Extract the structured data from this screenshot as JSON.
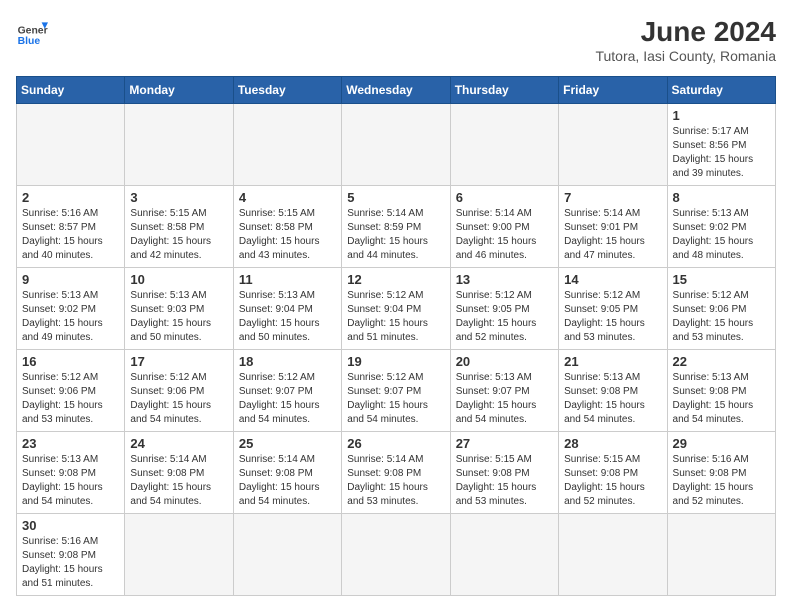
{
  "header": {
    "logo_general": "General",
    "logo_blue": "Blue",
    "title": "June 2024",
    "subtitle": "Tutora, Iasi County, Romania"
  },
  "days_of_week": [
    "Sunday",
    "Monday",
    "Tuesday",
    "Wednesday",
    "Thursday",
    "Friday",
    "Saturday"
  ],
  "weeks": [
    [
      {
        "day": "",
        "info": ""
      },
      {
        "day": "",
        "info": ""
      },
      {
        "day": "",
        "info": ""
      },
      {
        "day": "",
        "info": ""
      },
      {
        "day": "",
        "info": ""
      },
      {
        "day": "",
        "info": ""
      },
      {
        "day": "1",
        "info": "Sunrise: 5:17 AM\nSunset: 8:56 PM\nDaylight: 15 hours and 39 minutes."
      }
    ],
    [
      {
        "day": "2",
        "info": "Sunrise: 5:16 AM\nSunset: 8:57 PM\nDaylight: 15 hours and 40 minutes."
      },
      {
        "day": "3",
        "info": "Sunrise: 5:15 AM\nSunset: 8:58 PM\nDaylight: 15 hours and 42 minutes."
      },
      {
        "day": "4",
        "info": "Sunrise: 5:15 AM\nSunset: 8:58 PM\nDaylight: 15 hours and 43 minutes."
      },
      {
        "day": "5",
        "info": "Sunrise: 5:14 AM\nSunset: 8:59 PM\nDaylight: 15 hours and 44 minutes."
      },
      {
        "day": "6",
        "info": "Sunrise: 5:14 AM\nSunset: 9:00 PM\nDaylight: 15 hours and 46 minutes."
      },
      {
        "day": "7",
        "info": "Sunrise: 5:14 AM\nSunset: 9:01 PM\nDaylight: 15 hours and 47 minutes."
      },
      {
        "day": "8",
        "info": "Sunrise: 5:13 AM\nSunset: 9:02 PM\nDaylight: 15 hours and 48 minutes."
      }
    ],
    [
      {
        "day": "9",
        "info": "Sunrise: 5:13 AM\nSunset: 9:02 PM\nDaylight: 15 hours and 49 minutes."
      },
      {
        "day": "10",
        "info": "Sunrise: 5:13 AM\nSunset: 9:03 PM\nDaylight: 15 hours and 50 minutes."
      },
      {
        "day": "11",
        "info": "Sunrise: 5:13 AM\nSunset: 9:04 PM\nDaylight: 15 hours and 50 minutes."
      },
      {
        "day": "12",
        "info": "Sunrise: 5:12 AM\nSunset: 9:04 PM\nDaylight: 15 hours and 51 minutes."
      },
      {
        "day": "13",
        "info": "Sunrise: 5:12 AM\nSunset: 9:05 PM\nDaylight: 15 hours and 52 minutes."
      },
      {
        "day": "14",
        "info": "Sunrise: 5:12 AM\nSunset: 9:05 PM\nDaylight: 15 hours and 53 minutes."
      },
      {
        "day": "15",
        "info": "Sunrise: 5:12 AM\nSunset: 9:06 PM\nDaylight: 15 hours and 53 minutes."
      }
    ],
    [
      {
        "day": "16",
        "info": "Sunrise: 5:12 AM\nSunset: 9:06 PM\nDaylight: 15 hours and 53 minutes."
      },
      {
        "day": "17",
        "info": "Sunrise: 5:12 AM\nSunset: 9:06 PM\nDaylight: 15 hours and 54 minutes."
      },
      {
        "day": "18",
        "info": "Sunrise: 5:12 AM\nSunset: 9:07 PM\nDaylight: 15 hours and 54 minutes."
      },
      {
        "day": "19",
        "info": "Sunrise: 5:12 AM\nSunset: 9:07 PM\nDaylight: 15 hours and 54 minutes."
      },
      {
        "day": "20",
        "info": "Sunrise: 5:13 AM\nSunset: 9:07 PM\nDaylight: 15 hours and 54 minutes."
      },
      {
        "day": "21",
        "info": "Sunrise: 5:13 AM\nSunset: 9:08 PM\nDaylight: 15 hours and 54 minutes."
      },
      {
        "day": "22",
        "info": "Sunrise: 5:13 AM\nSunset: 9:08 PM\nDaylight: 15 hours and 54 minutes."
      }
    ],
    [
      {
        "day": "23",
        "info": "Sunrise: 5:13 AM\nSunset: 9:08 PM\nDaylight: 15 hours and 54 minutes."
      },
      {
        "day": "24",
        "info": "Sunrise: 5:14 AM\nSunset: 9:08 PM\nDaylight: 15 hours and 54 minutes."
      },
      {
        "day": "25",
        "info": "Sunrise: 5:14 AM\nSunset: 9:08 PM\nDaylight: 15 hours and 54 minutes."
      },
      {
        "day": "26",
        "info": "Sunrise: 5:14 AM\nSunset: 9:08 PM\nDaylight: 15 hours and 53 minutes."
      },
      {
        "day": "27",
        "info": "Sunrise: 5:15 AM\nSunset: 9:08 PM\nDaylight: 15 hours and 53 minutes."
      },
      {
        "day": "28",
        "info": "Sunrise: 5:15 AM\nSunset: 9:08 PM\nDaylight: 15 hours and 52 minutes."
      },
      {
        "day": "29",
        "info": "Sunrise: 5:16 AM\nSunset: 9:08 PM\nDaylight: 15 hours and 52 minutes."
      }
    ],
    [
      {
        "day": "30",
        "info": "Sunrise: 5:16 AM\nSunset: 9:08 PM\nDaylight: 15 hours and 51 minutes."
      },
      {
        "day": "",
        "info": ""
      },
      {
        "day": "",
        "info": ""
      },
      {
        "day": "",
        "info": ""
      },
      {
        "day": "",
        "info": ""
      },
      {
        "day": "",
        "info": ""
      },
      {
        "day": "",
        "info": ""
      }
    ]
  ]
}
